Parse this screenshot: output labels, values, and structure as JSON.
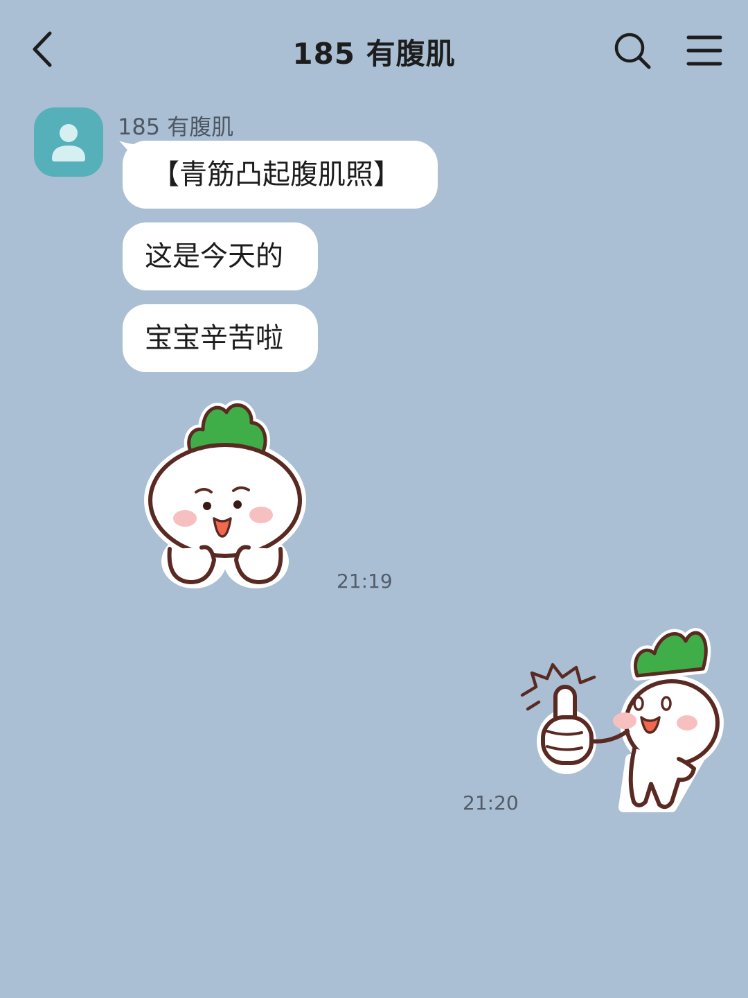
{
  "header": {
    "title": "185 有腹肌",
    "back_icon": "chevron-left-icon",
    "search_icon": "search-icon",
    "menu_icon": "hamburger-menu-icon"
  },
  "colors": {
    "background": "#aabfd4",
    "bubble": "#ffffff",
    "avatar": "#56b0b9",
    "radish_leaf": "#3fae49",
    "outline": "#5a2a22",
    "blush": "#f7c0c0"
  },
  "messages": [
    {
      "sender": "185 有腹肌",
      "avatar_icon": "user-avatar-icon",
      "texts": [
        "【青筋凸起腹肌照】",
        "这是今天的",
        "宝宝辛苦啦"
      ]
    },
    {
      "type": "sticker",
      "sticker": "worried-radish-sticker",
      "time": "21:19"
    },
    {
      "type": "sticker",
      "sticker": "thumbs-up-radish-sticker",
      "time": "21:20",
      "outgoing": true
    }
  ]
}
